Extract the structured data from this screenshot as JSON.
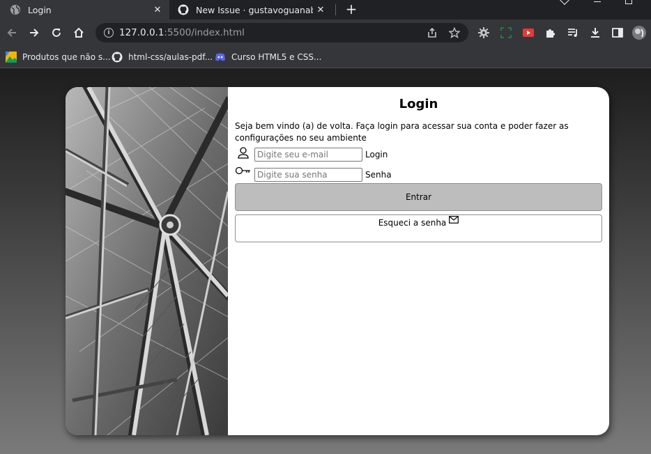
{
  "browser": {
    "tabs": [
      {
        "title": "Login",
        "favicon": "globe-icon",
        "active": true
      },
      {
        "title": "New Issue · gustavoguanabara/ht",
        "favicon": "github-icon",
        "active": false
      }
    ],
    "address_host": "127.0.0.1",
    "address_path": ":5500/index.html",
    "bookmarks": [
      {
        "label": "Produtos que não s...",
        "icon": "landscape-icon"
      },
      {
        "label": "html-css/aulas-pdf...",
        "icon": "github-icon"
      },
      {
        "label": "Curso HTML5 e CSS...",
        "icon": "discord-icon"
      }
    ]
  },
  "page": {
    "title": "Login",
    "intro": "Seja bem vindo (a) de volta. Faça login para acessar sua conta e poder fazer as configurações no seu ambiente",
    "email": {
      "placeholder": "Digite seu e-mail",
      "label": "Login",
      "icon": "user-icon"
    },
    "password": {
      "placeholder": "Digite sua senha",
      "label": "Senha",
      "icon": "key-icon"
    },
    "submit_label": "Entrar",
    "forgot_label": "Esqueci a senha",
    "forgot_icon": "mail-icon"
  }
}
